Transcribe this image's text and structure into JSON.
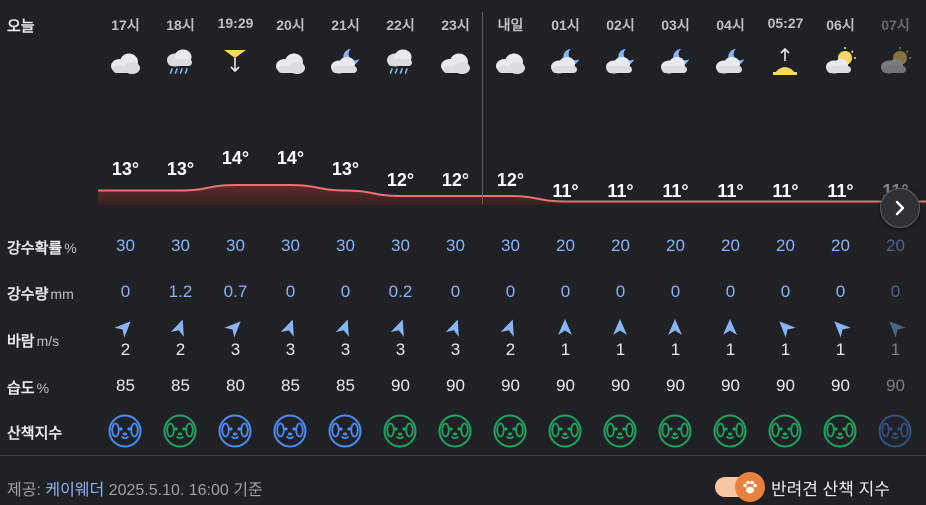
{
  "labels": {
    "today": "오늘",
    "precip_prob": "강수확률",
    "precip_prob_unit": "%",
    "precip_amount": "강수량",
    "precip_amount_unit": "mm",
    "wind": "바람",
    "wind_unit": "m/s",
    "humidity": "습도",
    "humidity_unit": "%",
    "walk_index": "산책지수"
  },
  "colors": {
    "prob": "#8ab4f8",
    "temp_line": "#e57373",
    "walk_blue": "#4c8df6",
    "walk_green": "#1fa463",
    "toggle": "#e8813d"
  },
  "hours": [
    {
      "time": "17시",
      "icon": "cloudy-icon",
      "temp": "13°",
      "temp_val": 13,
      "prob": "30",
      "amount": "0",
      "wind_dir": 45,
      "wind": "2",
      "humid": "85",
      "walk": "blue",
      "fade": false
    },
    {
      "time": "18시",
      "icon": "rain-icon",
      "temp": "13°",
      "temp_val": 13,
      "prob": "30",
      "amount": "1.2",
      "wind_dir": 20,
      "wind": "2",
      "humid": "85",
      "walk": "green",
      "fade": false
    },
    {
      "time": "19:29",
      "icon": "sunset-icon",
      "temp": "14°",
      "temp_val": 14,
      "prob": "30",
      "amount": "0.7",
      "wind_dir": 45,
      "wind": "3",
      "humid": "80",
      "walk": "blue",
      "fade": false
    },
    {
      "time": "20시",
      "icon": "cloudy-icon",
      "temp": "14°",
      "temp_val": 14,
      "prob": "30",
      "amount": "0",
      "wind_dir": 20,
      "wind": "3",
      "humid": "85",
      "walk": "blue",
      "fade": false
    },
    {
      "time": "21시",
      "icon": "cloudy-night-icon",
      "temp": "13°",
      "temp_val": 13,
      "prob": "30",
      "amount": "0",
      "wind_dir": 20,
      "wind": "3",
      "humid": "85",
      "walk": "blue",
      "fade": false
    },
    {
      "time": "22시",
      "icon": "rain-icon",
      "temp": "12°",
      "temp_val": 12,
      "prob": "30",
      "amount": "0.2",
      "wind_dir": 20,
      "wind": "3",
      "humid": "90",
      "walk": "green",
      "fade": false
    },
    {
      "time": "23시",
      "icon": "cloudy-icon",
      "temp": "12°",
      "temp_val": 12,
      "prob": "30",
      "amount": "0",
      "wind_dir": 20,
      "wind": "3",
      "humid": "90",
      "walk": "green",
      "fade": false
    },
    {
      "time": "내일",
      "icon": "cloudy-icon",
      "temp": "12°",
      "temp_val": 12,
      "prob": "30",
      "amount": "0",
      "wind_dir": 20,
      "wind": "2",
      "humid": "90",
      "walk": "green",
      "fade": false
    },
    {
      "time": "01시",
      "icon": "cloudy-night-icon",
      "temp": "11°",
      "temp_val": 11,
      "prob": "20",
      "amount": "0",
      "wind_dir": 0,
      "wind": "1",
      "humid": "90",
      "walk": "green",
      "fade": false
    },
    {
      "time": "02시",
      "icon": "cloudy-night-icon",
      "temp": "11°",
      "temp_val": 11,
      "prob": "20",
      "amount": "0",
      "wind_dir": 0,
      "wind": "1",
      "humid": "90",
      "walk": "green",
      "fade": false
    },
    {
      "time": "03시",
      "icon": "cloudy-night-icon",
      "temp": "11°",
      "temp_val": 11,
      "prob": "20",
      "amount": "0",
      "wind_dir": 0,
      "wind": "1",
      "humid": "90",
      "walk": "green",
      "fade": false
    },
    {
      "time": "04시",
      "icon": "cloudy-night-icon",
      "temp": "11°",
      "temp_val": 11,
      "prob": "20",
      "amount": "0",
      "wind_dir": 0,
      "wind": "1",
      "humid": "90",
      "walk": "green",
      "fade": false
    },
    {
      "time": "05:27",
      "icon": "sunrise-icon",
      "temp": "11°",
      "temp_val": 11,
      "prob": "20",
      "amount": "0",
      "wind_dir": -45,
      "wind": "1",
      "humid": "90",
      "walk": "green",
      "fade": false
    },
    {
      "time": "06시",
      "icon": "partly-cloudy-icon",
      "temp": "11°",
      "temp_val": 11,
      "prob": "20",
      "amount": "0",
      "wind_dir": -45,
      "wind": "1",
      "humid": "90",
      "walk": "green",
      "fade": false
    },
    {
      "time": "07시",
      "icon": "partly-cloudy-icon",
      "temp": "11°",
      "temp_val": 11,
      "prob": "20",
      "amount": "0",
      "wind_dir": -45,
      "wind": "1",
      "humid": "90",
      "walk": "blue",
      "fade": true
    }
  ],
  "footer": {
    "provided_by": "제공:",
    "provider": "케이웨더",
    "timestamp": "2025.5.10. 16:00 기준",
    "toggle_label": "반려견 산책 지수",
    "toggle_on": true
  }
}
